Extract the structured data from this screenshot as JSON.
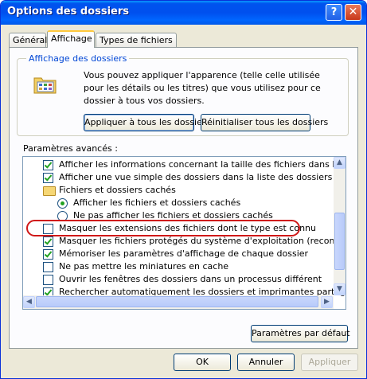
{
  "window": {
    "title": "Options des dossiers",
    "help_glyph": "?",
    "close_glyph": "✕"
  },
  "tabs": [
    {
      "label": "Général"
    },
    {
      "label": "Affichage"
    },
    {
      "label": "Types de fichiers"
    }
  ],
  "active_tab": "Affichage",
  "folder_view": {
    "title": "Affichage des dossiers",
    "description": "Vous pouvez appliquer l'apparence (telle celle utilisée pour les détails ou les titres) que vous utilisez pour ce dossier à tous vos dossiers.",
    "apply_all_label": "Appliquer à tous les dossiers",
    "reset_all_label": "Réinitialiser tous les dossiers"
  },
  "advanced": {
    "label": "Paramètres avancés :",
    "items": [
      {
        "type": "checkbox",
        "checked": true,
        "indent": 1,
        "label": "Afficher les informations concernant la taille des fichiers dans les info-bulles"
      },
      {
        "type": "checkbox",
        "checked": true,
        "indent": 1,
        "label": "Afficher une vue simple des dossiers dans la liste des dossiers de l'Explorateur"
      },
      {
        "type": "folder",
        "checked": false,
        "indent": 1,
        "label": "Fichiers et dossiers cachés"
      },
      {
        "type": "radio",
        "checked": true,
        "indent": 2,
        "label": "Afficher les fichiers et dossiers cachés"
      },
      {
        "type": "radio",
        "checked": false,
        "indent": 2,
        "label": "Ne pas afficher les fichiers et dossiers cachés"
      },
      {
        "type": "checkbox",
        "checked": false,
        "indent": 1,
        "label": "Masquer les extensions des fichiers dont le type est connu"
      },
      {
        "type": "checkbox",
        "checked": true,
        "indent": 1,
        "label": "Masquer les fichiers protégés du système d'exploitation (recommandé)"
      },
      {
        "type": "checkbox",
        "checked": true,
        "indent": 1,
        "label": "Mémoriser les paramètres d'affichage de chaque dossier"
      },
      {
        "type": "checkbox",
        "checked": false,
        "indent": 1,
        "label": "Ne pas mettre les miniatures en cache"
      },
      {
        "type": "checkbox",
        "checked": false,
        "indent": 1,
        "label": "Ouvrir les fenêtres des dossiers dans un processus différent"
      },
      {
        "type": "checkbox",
        "checked": true,
        "indent": 1,
        "label": "Rechercher automatiquement les dossiers et imprimantes partagés"
      }
    ],
    "defaults_label": "Paramètres par défaut"
  },
  "footer": {
    "ok_label": "OK",
    "cancel_label": "Annuler",
    "apply_label": "Appliquer"
  },
  "colors": {
    "titlebar": "#0054e3",
    "highlight": "#d01818",
    "group_title": "#0046d5",
    "check": "#21a121"
  }
}
